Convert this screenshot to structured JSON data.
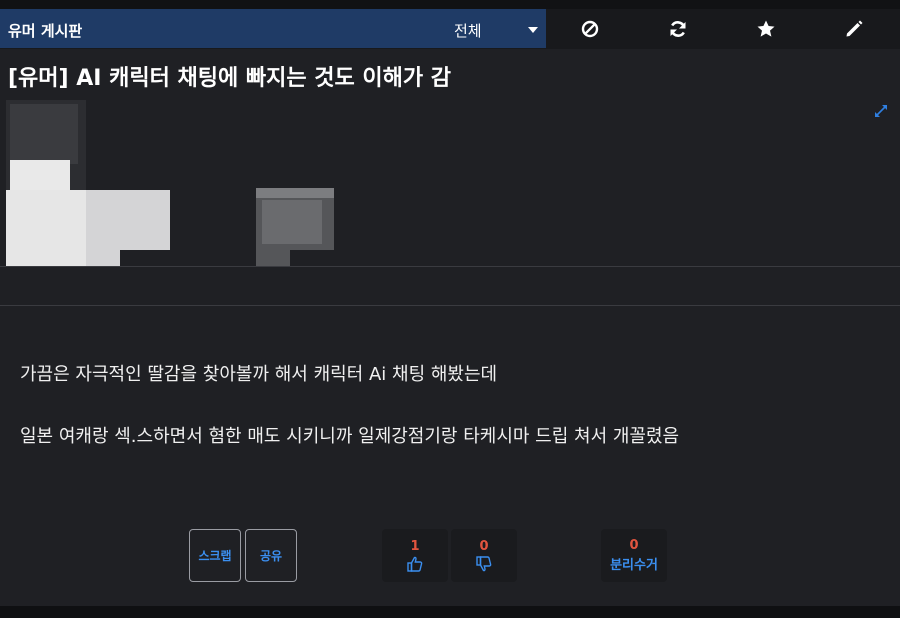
{
  "header": {
    "board_name": "유머 게시판",
    "filter": "전체",
    "tools": [
      {
        "name": "block-icon"
      },
      {
        "name": "refresh-icon"
      },
      {
        "name": "star-icon"
      },
      {
        "name": "pencil-icon"
      }
    ]
  },
  "post": {
    "title": "[유머] AI 캐릭터 채팅에 빠지는 것도 이해가 감",
    "body": [
      "가끔은 자극적인 딸감을 찾아볼까 해서 캐릭터 Ai 채팅 해봤는데",
      "일본 여캐랑 섹.스하면서 혐한 매도 시키니까 일제강점기랑 타케시마 드립 쳐서 개꼴렸음"
    ]
  },
  "actions": {
    "scrap_label": "스크랩",
    "share_label": "공유",
    "upvotes": "1",
    "downvotes": "0",
    "recycle_count": "0",
    "recycle_label": "분리수거"
  },
  "colors": {
    "accent": "#3b8ff0",
    "header_bg": "#1f3b66",
    "vote_count": "#e2553f",
    "background": "#1f2024"
  }
}
